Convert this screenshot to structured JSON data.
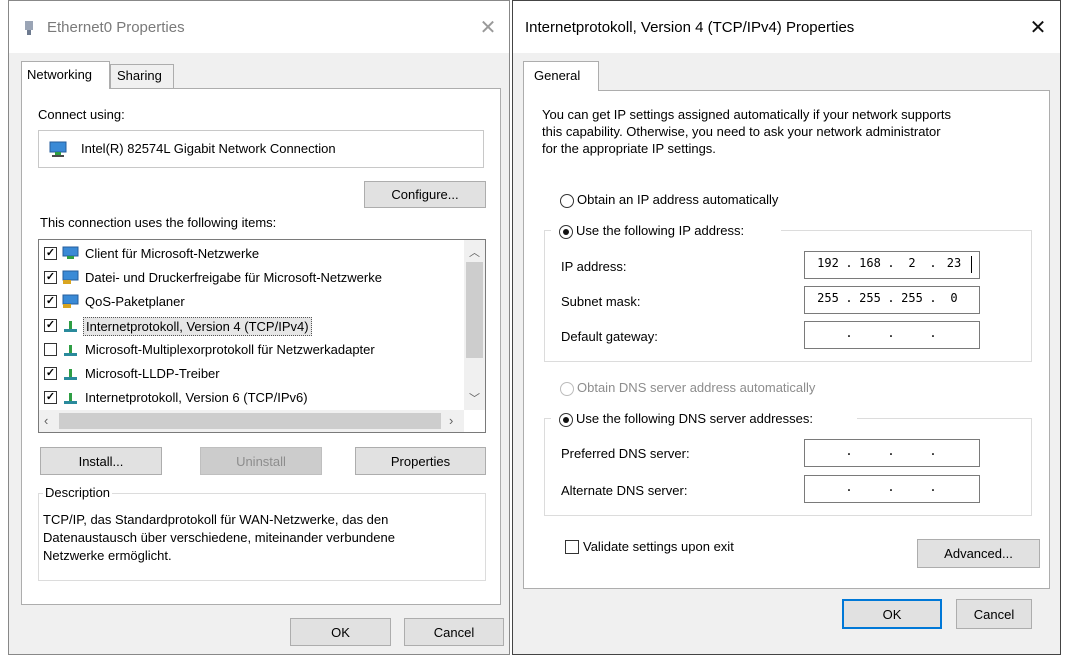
{
  "left_dialog": {
    "title": "Ethernet0 Properties",
    "tabs": [
      {
        "label": "Networking"
      },
      {
        "label": "Sharing"
      }
    ],
    "connect_using_label": "Connect using:",
    "adapter_name": "Intel(R) 82574L Gigabit Network Connection",
    "configure_button": "Configure...",
    "items_label": "This connection uses the following items:",
    "items": [
      {
        "label": "Client für Microsoft-Netzwerke",
        "checked": true,
        "icon": "network-client-icon"
      },
      {
        "label": "Datei- und Druckerfreigabe für Microsoft-Netzwerke",
        "checked": true,
        "icon": "network-service-icon"
      },
      {
        "label": "QoS-Paketplaner",
        "checked": true,
        "icon": "network-service-icon"
      },
      {
        "label": "Internetprotokoll, Version 4 (TCP/IPv4)",
        "checked": true,
        "icon": "protocol-icon",
        "selected": true
      },
      {
        "label": "Microsoft-Multiplexorprotokoll für Netzwerkadapter",
        "checked": false,
        "icon": "protocol-icon"
      },
      {
        "label": "Microsoft-LLDP-Treiber",
        "checked": true,
        "icon": "protocol-icon"
      },
      {
        "label": "Internetprotokoll, Version 6 (TCP/IPv6)",
        "checked": true,
        "icon": "protocol-icon"
      }
    ],
    "install_button": "Install...",
    "uninstall_button": "Uninstall",
    "properties_button": "Properties",
    "description_label": "Description",
    "description_lines": [
      "TCP/IP, das Standardprotokoll für WAN-Netzwerke, das den",
      "Datenaustausch über verschiedene, miteinander verbundene",
      "Netzwerke ermöglicht."
    ],
    "ok_button": "OK",
    "cancel_button": "Cancel"
  },
  "right_dialog": {
    "title": "Internetprotokoll, Version 4 (TCP/IPv4) Properties",
    "tab_general": "General",
    "intro_lines": [
      "You can get IP settings assigned automatically if your network supports",
      "this capability. Otherwise, you need to ask your network administrator",
      "for the appropriate IP settings."
    ],
    "obtain_ip_auto": "Obtain an IP address automatically",
    "use_following_ip": "Use the following IP address:",
    "ip_address_label": "IP address:",
    "ip_address": [
      "192",
      "168",
      "2",
      "23"
    ],
    "subnet_mask_label": "Subnet mask:",
    "subnet_mask": [
      "255",
      "255",
      "255",
      "0"
    ],
    "default_gateway_label": "Default gateway:",
    "default_gateway": [
      "",
      "",
      "",
      ""
    ],
    "obtain_dns_auto": "Obtain DNS server address automatically",
    "use_following_dns": "Use the following DNS server addresses:",
    "preferred_dns_label": "Preferred DNS server:",
    "preferred_dns": [
      "",
      "",
      "",
      ""
    ],
    "alternate_dns_label": "Alternate DNS server:",
    "alternate_dns": [
      "",
      "",
      "",
      ""
    ],
    "validate_label": "Validate settings upon exit",
    "advanced_button": "Advanced...",
    "ok_button": "OK",
    "cancel_button": "Cancel"
  },
  "colors": {
    "accent": "#0078d7",
    "border": "#adadad",
    "disabled_text": "#8d8d8d"
  }
}
